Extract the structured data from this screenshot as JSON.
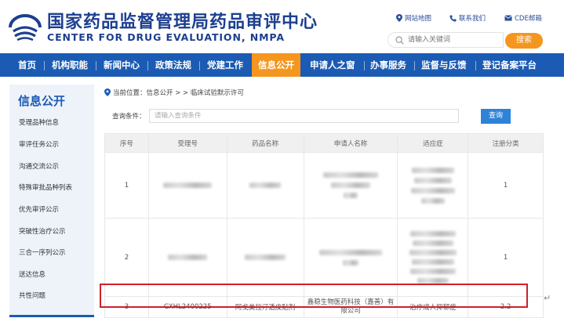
{
  "header": {
    "title_cn": "国家药品监督管理局药品审评中心",
    "title_en": "CENTER FOR DRUG EVALUATION, NMPA",
    "links": [
      {
        "label": "网站地图",
        "icon": "location-pin-icon"
      },
      {
        "label": "联系我们",
        "icon": "phone-icon"
      },
      {
        "label": "CDE邮箱",
        "icon": "mail-icon"
      }
    ],
    "search_placeholder": "请输入关键词",
    "search_button": "搜索"
  },
  "colors": {
    "brand_blue": "#1b5bb3",
    "accent_orange": "#f5961f",
    "highlight_red": "#d0202a"
  },
  "nav": [
    {
      "label": "首页",
      "active": false
    },
    {
      "label": "机构职能",
      "active": false
    },
    {
      "label": "新闻中心",
      "active": false
    },
    {
      "label": "政策法规",
      "active": false
    },
    {
      "label": "党建工作",
      "active": false
    },
    {
      "label": "信息公开",
      "active": true
    },
    {
      "label": "申请人之窗",
      "active": false
    },
    {
      "label": "办事服务",
      "active": false
    },
    {
      "label": "监督与反馈",
      "active": false
    },
    {
      "label": "登记备案平台",
      "active": false
    }
  ],
  "sidebar": {
    "title": "信息公开",
    "items": [
      {
        "label": "受理品种信息"
      },
      {
        "label": "审评任务公示"
      },
      {
        "label": "沟通交流公示"
      },
      {
        "label": "特殊审批品种列表"
      },
      {
        "label": "优先审评公示"
      },
      {
        "label": "突破性治疗公示"
      },
      {
        "label": "三合一序列公示"
      },
      {
        "label": "送达信息"
      },
      {
        "label": "共性问题"
      }
    ]
  },
  "breadcrumb": "当前位置：信息公开 > > 临床试验默示许可",
  "filter": {
    "label": "查询条件：",
    "placeholder": "请输入查询条件",
    "button": "查询"
  },
  "table": {
    "headers": [
      "序号",
      "受理号",
      "药品名称",
      "申请人名称",
      "适应症",
      "注册分类"
    ],
    "rows": [
      {
        "index": "1",
        "accept_no": "",
        "drug_name": "",
        "applicant": "",
        "indication": "",
        "category": "1",
        "blurred": true
      },
      {
        "index": "2",
        "accept_no": "",
        "drug_name": "",
        "applicant": "",
        "indication": "",
        "category": "1",
        "blurred": true
      },
      {
        "index": "3",
        "accept_no": "CXHL2400225",
        "drug_name": "阿戈美拉汀透皮贴剂",
        "applicant": "鑫稳生物医药科技（嘉善）有限公司",
        "indication": "治疗成人抑郁症",
        "category": "2.2",
        "blurred": false
      }
    ]
  },
  "return_mark": "↵"
}
